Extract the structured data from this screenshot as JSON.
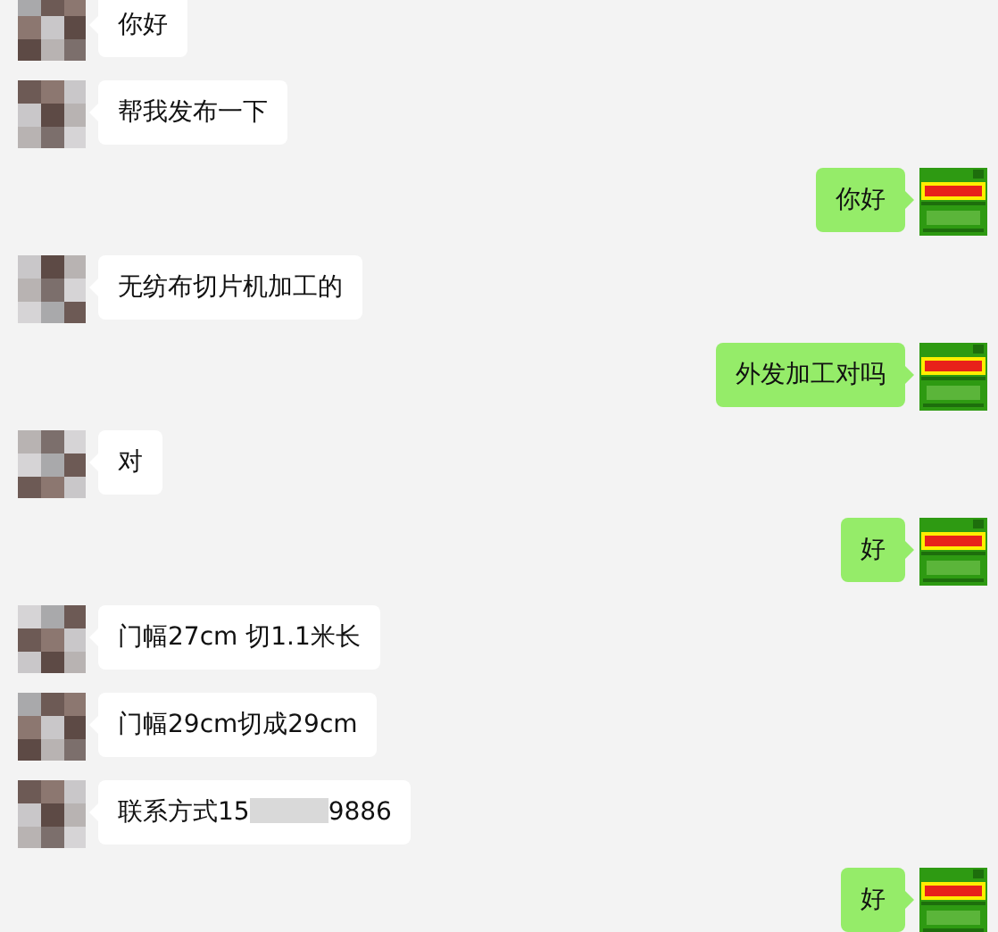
{
  "messages": [
    {
      "kind": "incoming",
      "text": "你好"
    },
    {
      "kind": "incoming",
      "text": "帮我发布一下"
    },
    {
      "kind": "outgoing",
      "text": "你好"
    },
    {
      "kind": "incoming",
      "text": "无纺布切片机加工的"
    },
    {
      "kind": "outgoing",
      "text": "外发加工对吗"
    },
    {
      "kind": "incoming",
      "text": "对"
    },
    {
      "kind": "outgoing",
      "text": "好"
    },
    {
      "kind": "incoming",
      "text": "门幅27cm 切1.1米长"
    },
    {
      "kind": "incoming",
      "text": "门幅29cm切成29cm"
    },
    {
      "kind": "incoming",
      "text": "联系方式15",
      "text_after_redaction": "9886"
    },
    {
      "kind": "outgoing",
      "text": "好"
    }
  ]
}
